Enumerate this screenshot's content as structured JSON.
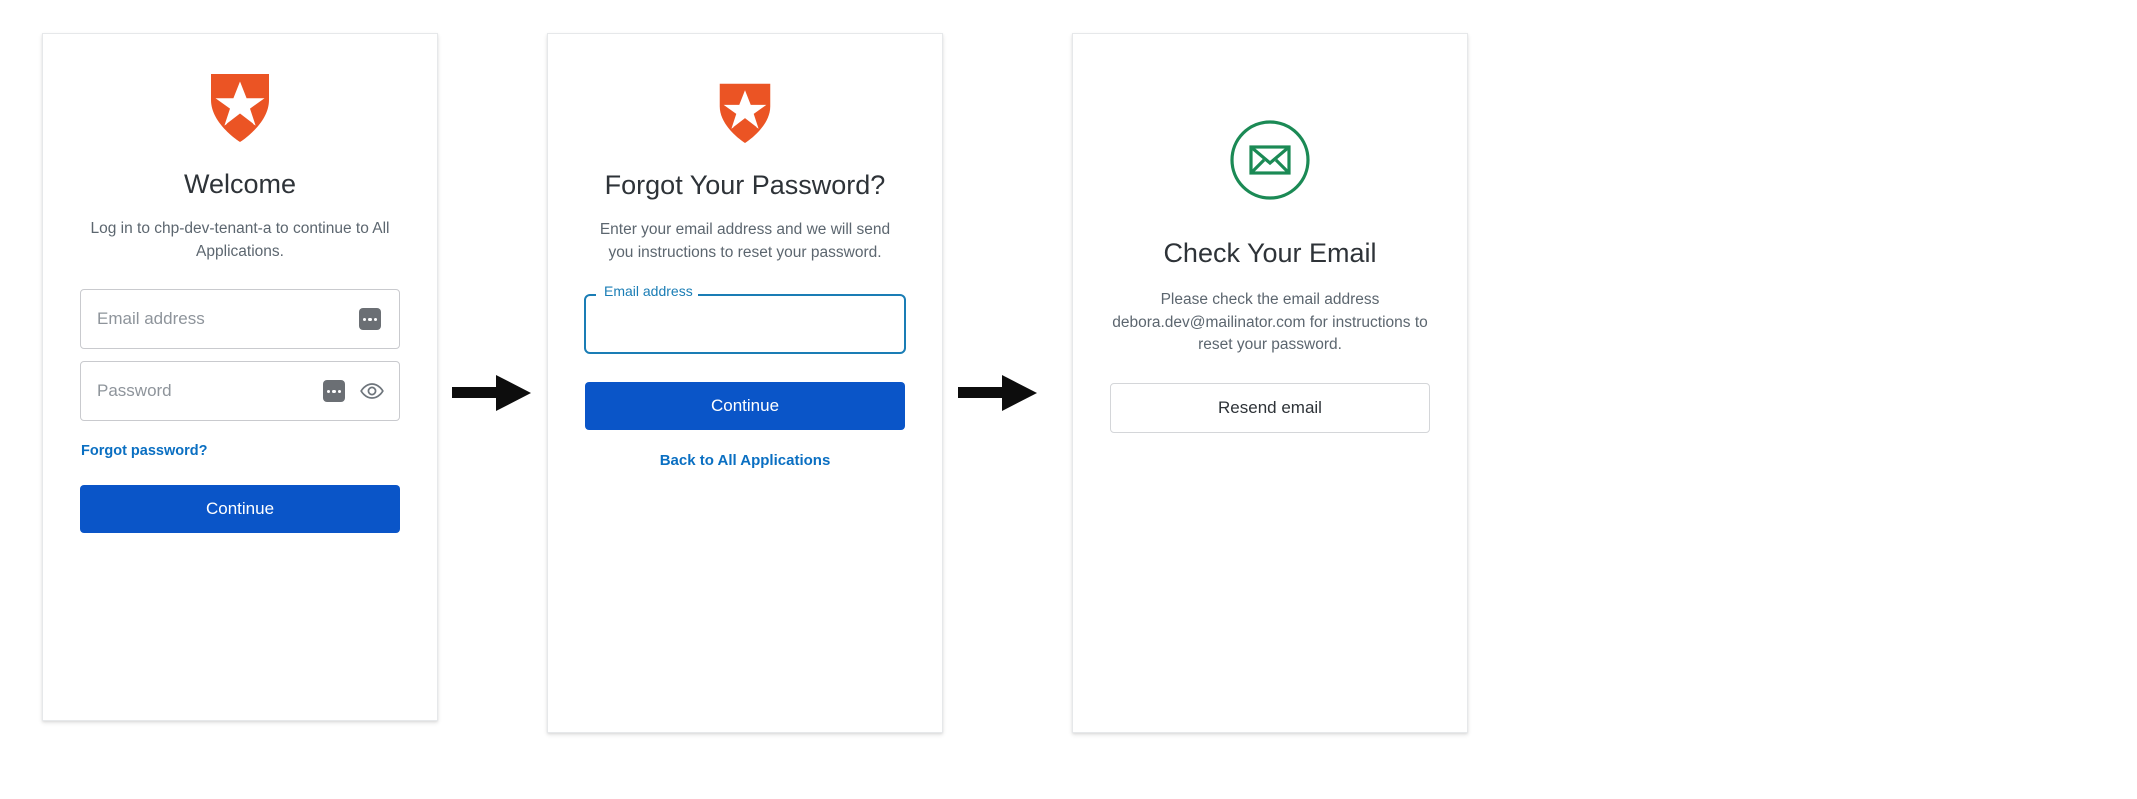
{
  "flow": {
    "arrows": [
      {
        "name": "arrow-login-to-forgot"
      },
      {
        "name": "arrow-forgot-to-check"
      }
    ]
  },
  "brand": {
    "logo_icon": "auth0-shield-icon",
    "logo_color": "#eb5424",
    "primary_button_color": "#0a55c8",
    "link_color": "#0a6fc2",
    "focus_color": "#1a7db5",
    "success_color": "#1b8a55"
  },
  "login_card": {
    "title": "Welcome",
    "subtitle": "Log in to chp-dev-tenant-a to continue to All Applications.",
    "email_field": {
      "placeholder": "Email address",
      "value": "",
      "autofill_icon": "autofill-icon"
    },
    "password_field": {
      "placeholder": "Password",
      "value": "",
      "autofill_icon": "autofill-icon",
      "reveal_icon": "eye-icon"
    },
    "forgot_link": "Forgot password?",
    "continue_button": "Continue"
  },
  "forgot_card": {
    "title": "Forgot Your Password?",
    "subtitle": "Enter your email address and we will send you instructions to reset your password.",
    "email_field": {
      "label": "Email address",
      "placeholder": "",
      "value": "",
      "focused": true
    },
    "continue_button": "Continue",
    "back_link": "Back to All Applications"
  },
  "check_card": {
    "status_icon": "envelope-in-circle-icon",
    "title": "Check Your Email",
    "subtitle": "Please check the email address debora.dev@mailinator.com for instructions to reset your password.",
    "resend_button": "Resend email"
  }
}
